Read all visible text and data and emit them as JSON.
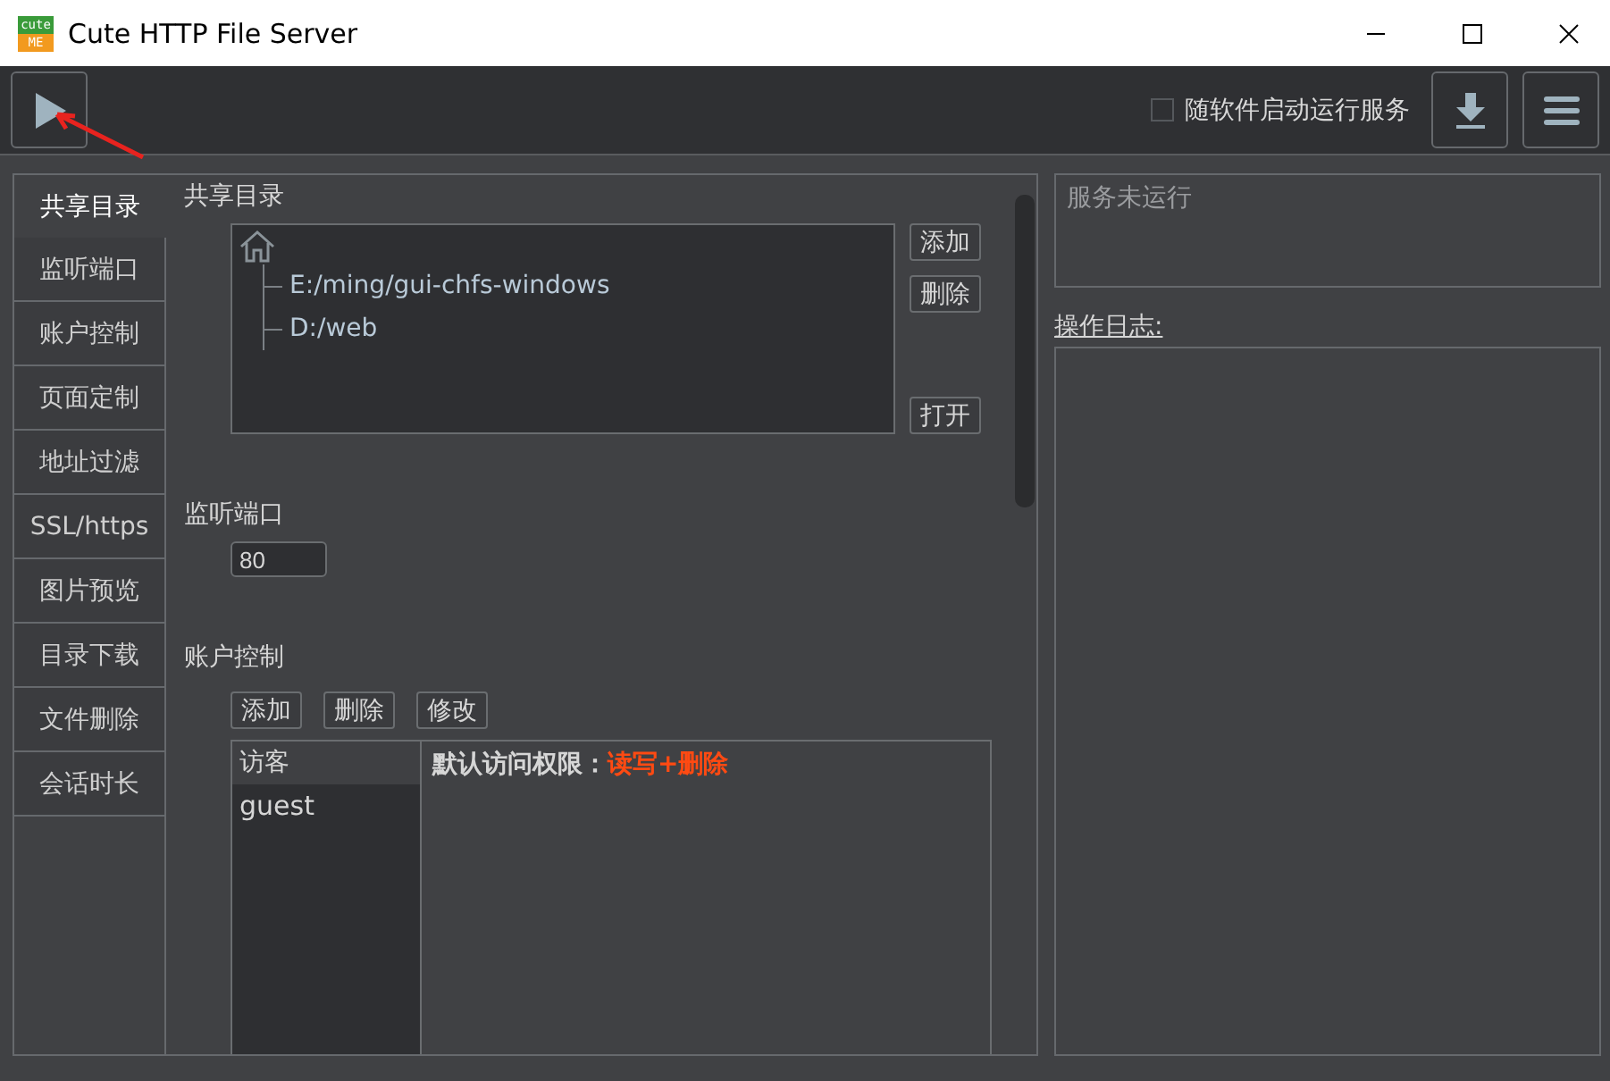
{
  "window": {
    "title": "Cute HTTP File Server",
    "logo_top": "cute",
    "logo_bottom": "ME"
  },
  "toolbar": {
    "autostart": {
      "label": "随软件启动运行服务",
      "checked": false
    }
  },
  "nav": [
    {
      "label": "共享目录",
      "selected": true
    },
    {
      "label": "监听端口",
      "selected": false
    },
    {
      "label": "账户控制",
      "selected": false
    },
    {
      "label": "页面定制",
      "selected": false
    },
    {
      "label": "地址过滤",
      "selected": false
    },
    {
      "label": "SSL/https",
      "selected": false
    },
    {
      "label": "图片预览",
      "selected": false
    },
    {
      "label": "目录下载",
      "selected": false
    },
    {
      "label": "文件删除",
      "selected": false
    },
    {
      "label": "会话时长",
      "selected": false
    }
  ],
  "shared_dirs": {
    "heading": "共享目录",
    "tree": {
      "children": [
        {
          "label": "E:/ming/gui-chfs-windows"
        },
        {
          "label": "D:/web"
        }
      ]
    },
    "buttons": [
      "添加",
      "删除",
      "打开"
    ]
  },
  "port": {
    "heading": "监听端口",
    "value": "80"
  },
  "accounts": {
    "heading": "账户控制",
    "buttons": [
      "添加",
      "删除",
      "修改"
    ],
    "list_header": "访客",
    "users": [
      {
        "name": "guest"
      }
    ],
    "permission_label": "默认访问权限：",
    "permission_value": "读写+删除"
  },
  "status": {
    "text": "服务未运行"
  },
  "log": {
    "label": "操作日志:"
  }
}
